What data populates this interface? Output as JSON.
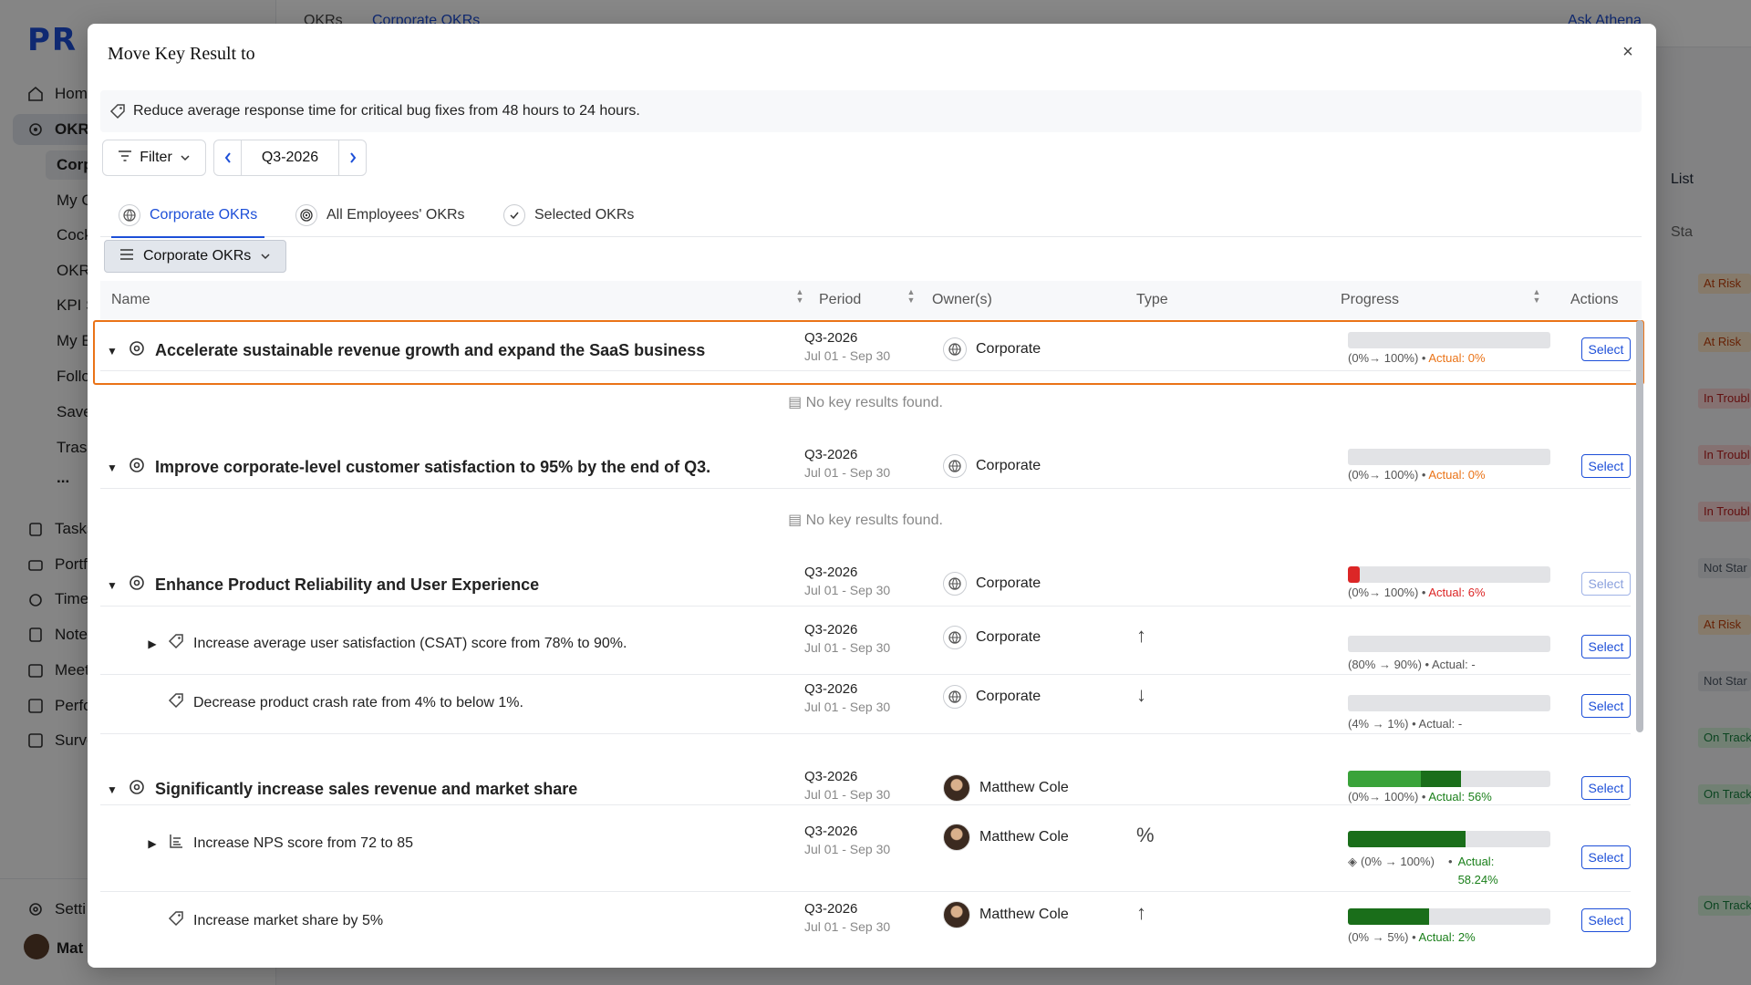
{
  "background": {
    "logo": "PR",
    "breadcrumb": [
      "OKRs",
      "Corporate OKRs"
    ],
    "ask_label": "Ask Athena",
    "view_label": "List",
    "status_header": "Sta",
    "nav": [
      "Home",
      "OKRs",
      "Tasks",
      "Portf",
      "Time",
      "Notes",
      "Meet",
      "Perfo",
      "Surve",
      "Setti"
    ],
    "okr_sub": [
      "Corp",
      "My C",
      "Cock",
      "OKR",
      "KPI S",
      "My E",
      "Follo",
      "Save",
      "Tras"
    ],
    "more": "...",
    "user": "Mat",
    "statuses": [
      "At Risk",
      "At Risk",
      "In Troubl",
      "In Troubl",
      "In Troubl",
      "Not Star",
      "At Risk",
      "Not Star",
      "On Track",
      "On Track",
      "On Track"
    ]
  },
  "modal": {
    "title": "Move Key Result to",
    "close": "×",
    "key_result": "Reduce average response time for critical bug fixes from 48 hours to 24 hours.",
    "filter_label": "Filter",
    "period": "Q3-2026",
    "tabs": [
      "Corporate OKRs",
      "All Employees' OKRs",
      "Selected OKRs"
    ],
    "view_selector": "Corporate OKRs",
    "columns": [
      "Name",
      "Period",
      "Owner(s)",
      "Type",
      "Progress",
      "Actions"
    ],
    "empty_message": "No key results found.",
    "select_label": "Select",
    "rows": [
      {
        "kind": "objective",
        "name": "Accelerate sustainable revenue growth and expand the SaaS business",
        "period": "Q3-2026",
        "dates": "Jul 01 - Sep 30",
        "owner": "Corporate",
        "progress": 0,
        "range": "(0%→ 100%)",
        "actual": "Actual: 0%"
      },
      {
        "kind": "objective",
        "name": "Improve corporate-level customer satisfaction to 95% by the end of Q3.",
        "period": "Q3-2026",
        "dates": "Jul 01 - Sep 30",
        "owner": "Corporate",
        "progress": 0,
        "range": "(0%→ 100%)",
        "actual": "Actual: 0%"
      },
      {
        "kind": "objective",
        "name": "Enhance Product Reliability and User Experience",
        "period": "Q3-2026",
        "dates": "Jul 01 - Sep 30",
        "owner": "Corporate",
        "progress": 6,
        "range": "(0%→ 100%)",
        "actual": "Actual: 6%"
      },
      {
        "kind": "kr",
        "name": "Increase average user satisfaction (CSAT) score from 78% to 90%.",
        "period": "Q3-2026",
        "dates": "Jul 01 - Sep 30",
        "owner": "Corporate",
        "type": "↑",
        "progress": 0,
        "range": "(80% → 90%)",
        "actual": "Actual: -"
      },
      {
        "kind": "kr",
        "name": "Decrease product crash rate from 4% to below 1%.",
        "period": "Q3-2026",
        "dates": "Jul 01 - Sep 30",
        "owner": "Corporate",
        "type": "↓",
        "progress": 0,
        "range": "(4% → 1%)",
        "actual": "Actual: -"
      },
      {
        "kind": "objective",
        "name": "Significantly increase sales revenue and market share",
        "period": "Q3-2026",
        "dates": "Jul 01 - Sep 30",
        "owner": "Matthew Cole",
        "progress": 56,
        "range": "(0%→ 100%)",
        "actual": "Actual: 56%"
      },
      {
        "kind": "kr",
        "name": "Increase NPS score from 72 to 85",
        "period": "Q3-2026",
        "dates": "Jul 01 - Sep 30",
        "owner": "Matthew Cole",
        "type": "%",
        "progress": 58.24,
        "range": "(0% → 100%)",
        "actual": "Actual: 58.24%"
      },
      {
        "kind": "kr",
        "name": "Increase market share by 5%",
        "period": "Q3-2026",
        "dates": "Jul 01 - Sep 30",
        "owner": "Matthew Cole",
        "type": "↑",
        "progress": 40,
        "range": "(0% → 5%)",
        "actual": "Actual: 2%"
      }
    ]
  },
  "colors": {
    "accent": "#1d4fd8",
    "highlight": "#ea7317",
    "red": "#dc2626",
    "green_light": "#3aa33a",
    "green_dark": "#1a6e1a"
  }
}
